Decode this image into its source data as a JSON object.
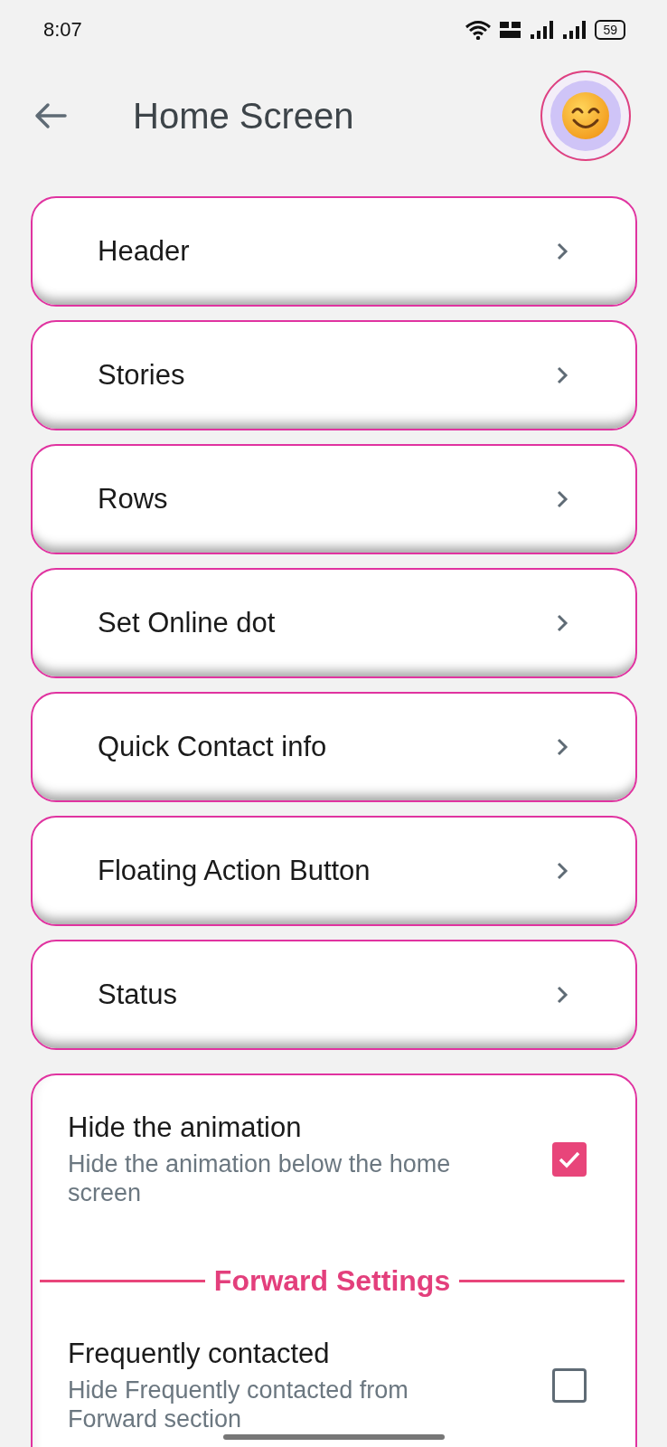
{
  "status_bar": {
    "time": "8:07",
    "battery": "59"
  },
  "header": {
    "title": "Home Screen"
  },
  "menu_items": [
    {
      "label": "Header"
    },
    {
      "label": "Stories"
    },
    {
      "label": "Rows"
    },
    {
      "label": "Set Online dot"
    },
    {
      "label": "Quick Contact info"
    },
    {
      "label": "Floating Action Button"
    },
    {
      "label": "Status"
    }
  ],
  "settings_card": {
    "items": [
      {
        "kind": "checkbox",
        "title": "Hide the animation",
        "description": "Hide the animation below the home screen",
        "checked": true
      },
      {
        "kind": "section",
        "title": "Forward Settings"
      },
      {
        "kind": "checkbox",
        "title": "Frequently contacted",
        "description": "Hide Frequently contacted from Forward section",
        "checked": false
      }
    ]
  }
}
